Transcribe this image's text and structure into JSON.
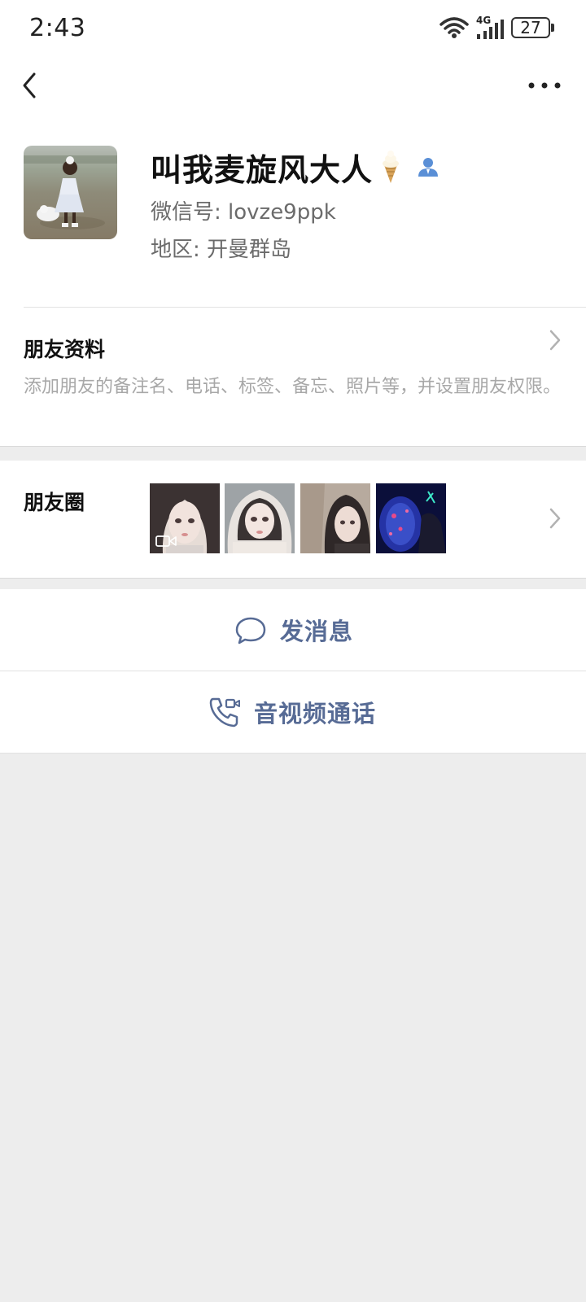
{
  "status_bar": {
    "time": "2:43",
    "network": "4G",
    "battery": "27"
  },
  "profile": {
    "nickname": "叫我麦旋风大人",
    "wechat_id": "微信号: lovze9ppk",
    "region": "地区: 开曼群岛"
  },
  "friend_info": {
    "title": "朋友资料",
    "description": "添加朋友的备注名、电话、标签、备忘、照片等，并设置朋友权限。"
  },
  "moments": {
    "title": "朋友圈",
    "thumbnail_count": 4
  },
  "actions": {
    "message_label": "发消息",
    "call_label": "音视频通话"
  },
  "colors": {
    "link": "#576b95",
    "background": "#ededed",
    "card": "#ffffff"
  },
  "icons": [
    "wifi-icon",
    "signal-icon",
    "battery-icon",
    "back-arrow-icon",
    "more-dots-icon",
    "ice-cream-icon",
    "contact-person-icon",
    "chevron-right-icon",
    "video-badge-icon",
    "chat-bubble-icon",
    "phone-video-icon"
  ]
}
